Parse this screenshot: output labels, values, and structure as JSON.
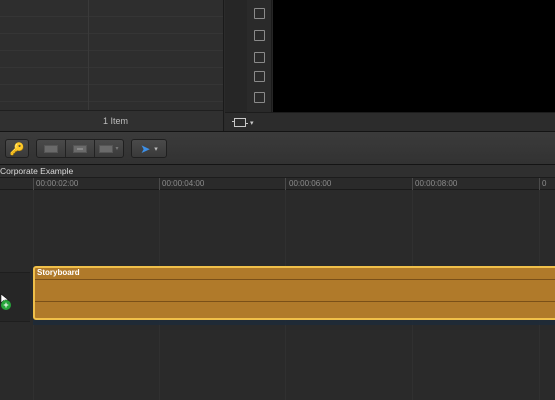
{
  "browser": {
    "item_count": "1 Item"
  },
  "viewer": {
    "crop_tool_arrow": "▾"
  },
  "toolbar": {
    "key_icon": "🔑",
    "select_arrow": "▾"
  },
  "timeline": {
    "project_name": "Corporate Example",
    "ruler_ticks": [
      "00:00:02:00",
      "00:00:04:00",
      "00:00:06:00",
      "00:00:08:00",
      "0"
    ],
    "clip": {
      "label": "Storyboard",
      "color": "#b07a2a",
      "selected_border": "#f0c04a"
    }
  },
  "colors": {
    "accent": "#3d8fe6",
    "add_badge": "#27a53b"
  }
}
